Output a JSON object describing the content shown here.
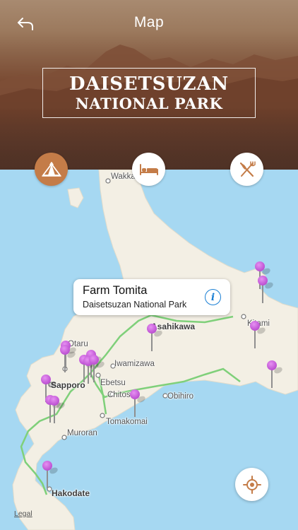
{
  "header": {
    "title": "Map",
    "park_name_line1": "DAISETSUZAN",
    "park_name_line2": "NATIONAL PARK"
  },
  "categories": [
    {
      "name": "camping",
      "icon": "tent-icon",
      "selected": true
    },
    {
      "name": "hotels",
      "icon": "bed-icon",
      "selected": false
    },
    {
      "name": "restaurants",
      "icon": "fork-knife-icon",
      "selected": false
    }
  ],
  "map": {
    "places": [
      "Wakkanai",
      "Asahikawa",
      "Kitami",
      "Otaru",
      "Iwamizawa",
      "Sapporo",
      "Ebetsu",
      "Chitose",
      "Obihiro",
      "Tomakomai",
      "Muroran",
      "Hakodate"
    ],
    "callout": {
      "title": "Farm Tomita",
      "subtitle": "Daisetsuzan National Park",
      "info_symbol": "i"
    },
    "legal": "Legal"
  },
  "colors": {
    "water": "#a6d8f2",
    "land": "#f3efe4",
    "road": "#7fd07a",
    "pin": "#c259d6",
    "accent_button": "#c47c48",
    "info": "#1a7fd4"
  }
}
